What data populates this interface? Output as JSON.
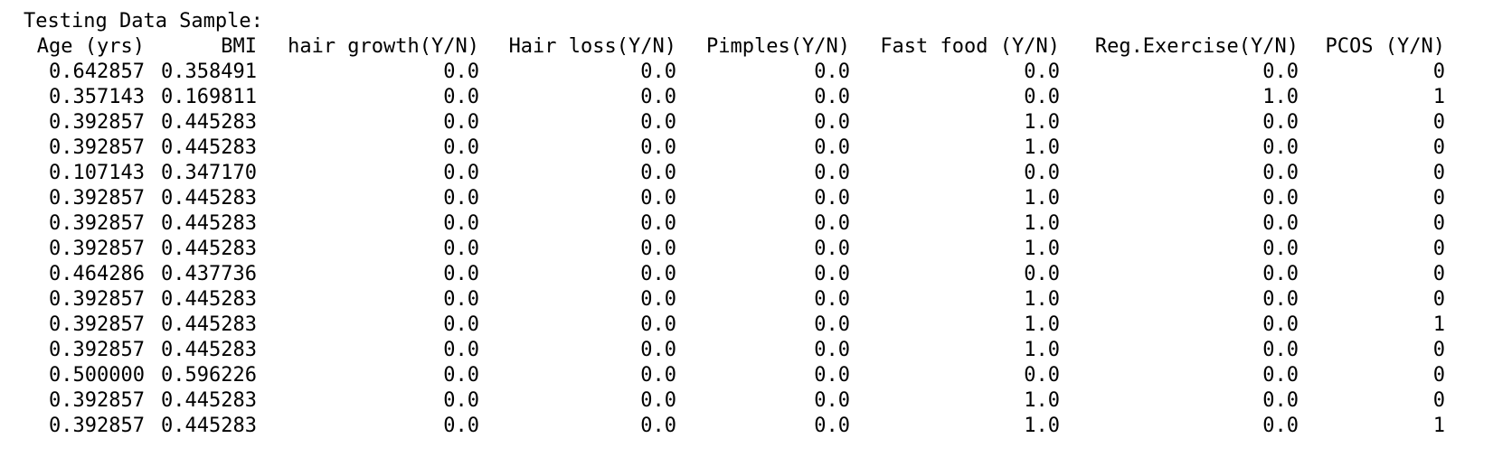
{
  "title": "Testing Data Sample:",
  "columns": [
    "Age (yrs)",
    "BMI",
    "hair growth(Y/N)",
    "Hair loss(Y/N)",
    "Pimples(Y/N)",
    "Fast food (Y/N)",
    "Reg.Exercise(Y/N)",
    "PCOS (Y/N)"
  ],
  "rows": [
    [
      "0.642857",
      "0.358491",
      "0.0",
      "0.0",
      "0.0",
      "0.0",
      "0.0",
      "0"
    ],
    [
      "0.357143",
      "0.169811",
      "0.0",
      "0.0",
      "0.0",
      "0.0",
      "1.0",
      "1"
    ],
    [
      "0.392857",
      "0.445283",
      "0.0",
      "0.0",
      "0.0",
      "1.0",
      "0.0",
      "0"
    ],
    [
      "0.392857",
      "0.445283",
      "0.0",
      "0.0",
      "0.0",
      "1.0",
      "0.0",
      "0"
    ],
    [
      "0.107143",
      "0.347170",
      "0.0",
      "0.0",
      "0.0",
      "0.0",
      "0.0",
      "0"
    ],
    [
      "0.392857",
      "0.445283",
      "0.0",
      "0.0",
      "0.0",
      "1.0",
      "0.0",
      "0"
    ],
    [
      "0.392857",
      "0.445283",
      "0.0",
      "0.0",
      "0.0",
      "1.0",
      "0.0",
      "0"
    ],
    [
      "0.392857",
      "0.445283",
      "0.0",
      "0.0",
      "0.0",
      "1.0",
      "0.0",
      "0"
    ],
    [
      "0.464286",
      "0.437736",
      "0.0",
      "0.0",
      "0.0",
      "0.0",
      "0.0",
      "0"
    ],
    [
      "0.392857",
      "0.445283",
      "0.0",
      "0.0",
      "0.0",
      "1.0",
      "0.0",
      "0"
    ],
    [
      "0.392857",
      "0.445283",
      "0.0",
      "0.0",
      "0.0",
      "1.0",
      "0.0",
      "1"
    ],
    [
      "0.392857",
      "0.445283",
      "0.0",
      "0.0",
      "0.0",
      "1.0",
      "0.0",
      "0"
    ],
    [
      "0.500000",
      "0.596226",
      "0.0",
      "0.0",
      "0.0",
      "0.0",
      "0.0",
      "0"
    ],
    [
      "0.392857",
      "0.445283",
      "0.0",
      "0.0",
      "0.0",
      "1.0",
      "0.0",
      "0"
    ],
    [
      "0.392857",
      "0.445283",
      "0.0",
      "0.0",
      "0.0",
      "1.0",
      "0.0",
      "1"
    ]
  ]
}
